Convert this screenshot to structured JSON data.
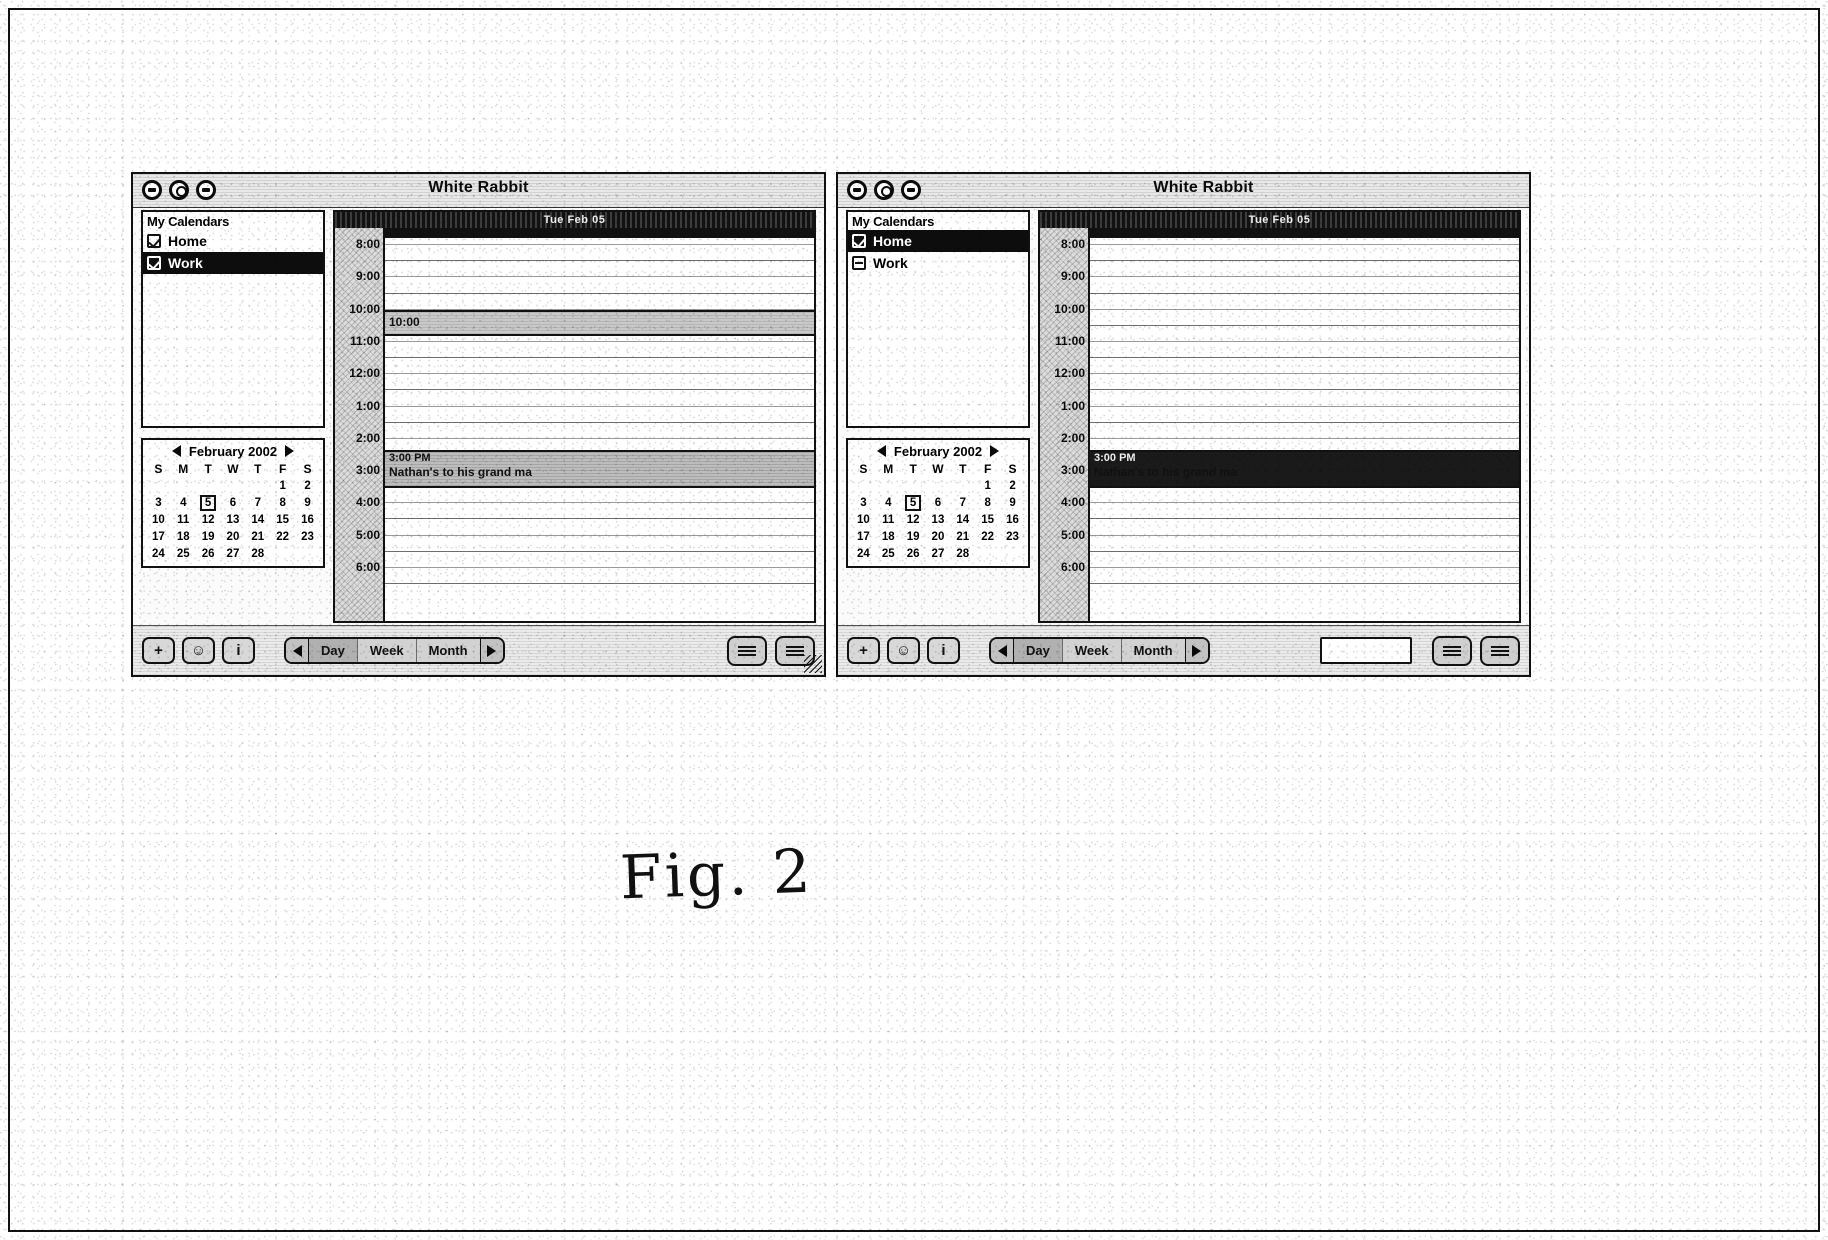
{
  "figure": {
    "caption": "Fig. 2"
  },
  "windows": [
    {
      "id": "left",
      "title": "White Rabbit",
      "traffic_icons": [
        "close-icon",
        "minimize-icon",
        "zoom-icon"
      ],
      "sidebar": {
        "header": "My Calendars",
        "items": [
          {
            "label": "Home",
            "checked": true,
            "selected": false
          },
          {
            "label": "Work",
            "checked": true,
            "selected": true
          }
        ]
      },
      "mini_calendar": {
        "month_label": "February 2002",
        "prev_icon": "chevron-left-icon",
        "next_icon": "chevron-right-icon",
        "weekdays": [
          "S",
          "M",
          "T",
          "W",
          "T",
          "F",
          "S"
        ],
        "weeks": [
          [
            "",
            "",
            "",
            "",
            "",
            "1",
            "2"
          ],
          [
            "3",
            "4",
            "5",
            "6",
            "7",
            "8",
            "9"
          ],
          [
            "10",
            "11",
            "12",
            "13",
            "14",
            "15",
            "16"
          ],
          [
            "17",
            "18",
            "19",
            "20",
            "21",
            "22",
            "23"
          ],
          [
            "24",
            "25",
            "26",
            "27",
            "28",
            "",
            ""
          ]
        ],
        "today": "5"
      },
      "dayview": {
        "date_header": "Tue Feb 05",
        "hours": [
          "8:00",
          "9:00",
          "10:00",
          "11:00",
          "12:00",
          "1:00",
          "2:00",
          "3:00",
          "4:00",
          "5:00",
          "6:00"
        ],
        "events": [
          {
            "time": "10:00",
            "title": "10:00",
            "style": "bar"
          },
          {
            "time": "3:00 PM",
            "title": "Nathan's to his grand ma",
            "style": "block"
          }
        ]
      },
      "toolbar": {
        "buttons": [
          {
            "icon": "add-icon",
            "glyph": "+"
          },
          {
            "icon": "person-icon",
            "glyph": "☺"
          },
          {
            "icon": "info-icon",
            "glyph": "i"
          }
        ],
        "prev_icon": "chevron-left-icon",
        "next_icon": "chevron-right-icon",
        "views": [
          "Day",
          "Week",
          "Month"
        ],
        "active_view": "Day",
        "has_search": false,
        "right_buttons": [
          {
            "icon": "list-view-icon"
          },
          {
            "icon": "send-icon"
          }
        ]
      }
    },
    {
      "id": "right",
      "title": "White Rabbit",
      "traffic_icons": [
        "close-icon",
        "minimize-icon",
        "zoom-icon"
      ],
      "sidebar": {
        "header": "My Calendars",
        "items": [
          {
            "label": "Home",
            "checked": true,
            "selected": true
          },
          {
            "label": "Work",
            "checked": false,
            "selected": false
          }
        ]
      },
      "mini_calendar": {
        "month_label": "February 2002",
        "prev_icon": "chevron-left-icon",
        "next_icon": "chevron-right-icon",
        "weekdays": [
          "S",
          "M",
          "T",
          "W",
          "T",
          "F",
          "S"
        ],
        "weeks": [
          [
            "",
            "",
            "",
            "",
            "",
            "1",
            "2"
          ],
          [
            "3",
            "4",
            "5",
            "6",
            "7",
            "8",
            "9"
          ],
          [
            "10",
            "11",
            "12",
            "13",
            "14",
            "15",
            "16"
          ],
          [
            "17",
            "18",
            "19",
            "20",
            "21",
            "22",
            "23"
          ],
          [
            "24",
            "25",
            "26",
            "27",
            "28",
            "",
            ""
          ]
        ],
        "today": "5"
      },
      "dayview": {
        "date_header": "Tue Feb 05",
        "hours": [
          "8:00",
          "9:00",
          "10:00",
          "11:00",
          "12:00",
          "1:00",
          "2:00",
          "3:00",
          "4:00",
          "5:00",
          "6:00"
        ],
        "events": [
          {
            "time": "3:00 PM",
            "title": "Nathan's to his grand ma",
            "style": "block"
          }
        ]
      },
      "toolbar": {
        "buttons": [
          {
            "icon": "add-icon",
            "glyph": "+"
          },
          {
            "icon": "person-icon",
            "glyph": "☺"
          },
          {
            "icon": "info-icon",
            "glyph": "i"
          }
        ],
        "prev_icon": "chevron-left-icon",
        "next_icon": "chevron-right-icon",
        "views": [
          "Day",
          "Week",
          "Month"
        ],
        "active_view": "Day",
        "has_search": true,
        "search_value": "",
        "right_buttons": [
          {
            "icon": "list-view-icon"
          },
          {
            "icon": "send-icon"
          }
        ]
      }
    }
  ]
}
